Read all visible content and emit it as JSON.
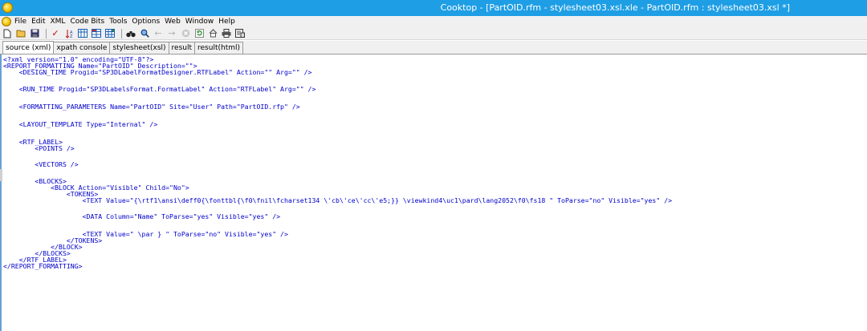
{
  "window": {
    "title": "Cooktop - [PartOID.rfm - stylesheet03.xsl.xle - PartOID.rfm : stylesheet03.xsl *]"
  },
  "menu": {
    "items": [
      "File",
      "Edit",
      "XML",
      "Code Bits",
      "Tools",
      "Options",
      "Web",
      "Window",
      "Help"
    ]
  },
  "toolbar": {
    "buttons": [
      "new-file-icon",
      "open-folder-icon",
      "save-icon",
      "check-icon",
      "sort-icon",
      "grid-a-icon",
      "grid-b-icon",
      "grid-c-icon",
      "binoculars-icon",
      "zoom-icon",
      "back-arrow-icon",
      "forward-arrow-icon",
      "stop-icon",
      "refresh-icon",
      "home-icon",
      "print-icon",
      "properties-icon"
    ]
  },
  "tabs": [
    {
      "label": "source (xml)",
      "active": true
    },
    {
      "label": "xpath console",
      "active": false
    },
    {
      "label": "stylesheet(xsl)",
      "active": false
    },
    {
      "label": "result",
      "active": false
    },
    {
      "label": "result(html)",
      "active": false
    }
  ],
  "code_lines": [
    "<?xml version=\"1.0\" encoding=\"UTF-8\"?>",
    "<REPORT_FORMATTING Name=\"PartOID\" Description=\"\">",
    "    <DESIGN_TIME Progid=\"SP3DLabelFormatDesigner.RTFLabel\" Action=\"\" Arg=\"\" />",
    "",
    "    <RUN_TIME Progid=\"SP3DLabelsFormat.FormatLabel\" Action=\"RTFLabel\" Arg=\"\" />",
    "",
    "    <FORMATTING_PARAMETERS Name=\"PartOID\" Site=\"User\" Path=\"PartOID.rfp\" />",
    "",
    "    <LAYOUT_TEMPLATE Type=\"Internal\" />",
    "",
    "    <RTF_LABEL>",
    "        <POINTS />",
    "",
    "        <VECTORS />",
    "",
    "        <BLOCKS>",
    "            <BLOCK Action=\"Visible\" Child=\"No\">",
    "                <TOKENS>",
    "                    <TEXT Value=\"{\\rtf1\\ansi\\deff0{\\fonttbl{\\f0\\fnil\\fcharset134 \\'cb\\'ce\\'cc\\'e5;}} \\viewkind4\\uc1\\pard\\lang2052\\f0\\fs18 \" ToParse=\"no\" Visible=\"yes\" />",
    "",
    "                    <DATA Column=\"Name\" ToParse=\"yes\" Visible=\"yes\" />",
    "",
    "                    <TEXT Value=\" \\par } \" ToParse=\"no\" Visible=\"yes\" />",
    "                </TOKENS>",
    "            </BLOCK>",
    "        </BLOCKS>",
    "    </RTF_LABEL>",
    "</REPORT_FORMATTING>"
  ]
}
